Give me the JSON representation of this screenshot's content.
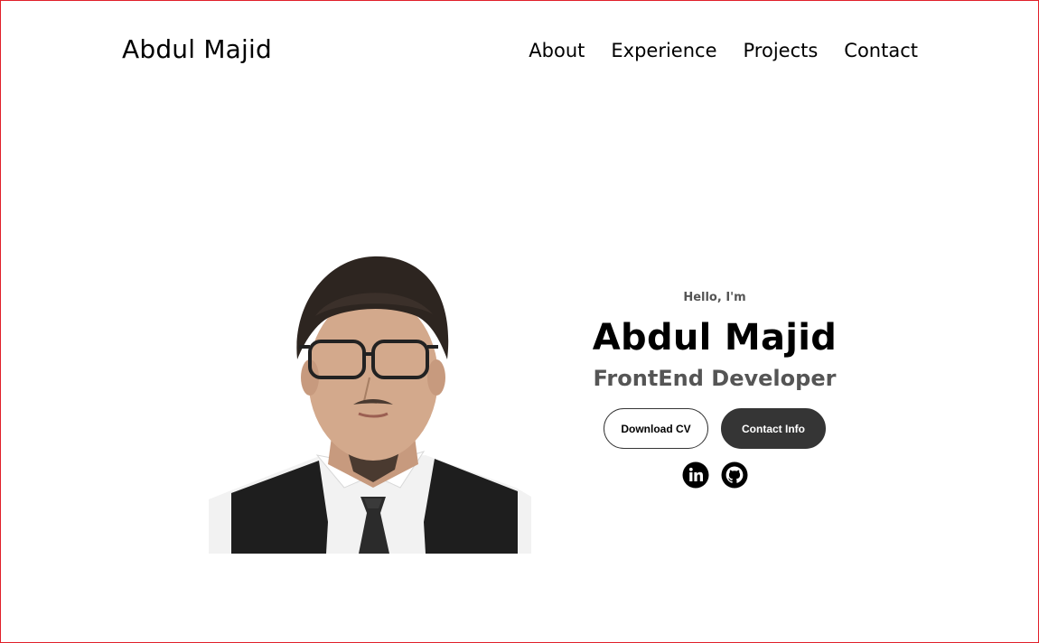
{
  "header": {
    "logo": "Abdul Majid",
    "nav": [
      {
        "label": "About"
      },
      {
        "label": "Experience"
      },
      {
        "label": "Projects"
      },
      {
        "label": "Contact"
      }
    ]
  },
  "hero": {
    "greeting": "Hello, I'm",
    "name": "Abdul Majid",
    "title": "FrontEnd Developer",
    "buttons": {
      "download_cv": "Download CV",
      "contact_info": "Contact Info"
    },
    "socials": [
      {
        "icon": "linkedin-icon"
      },
      {
        "icon": "github-icon"
      }
    ],
    "profile_picture": {
      "alt": "Abdul Majid profile picture"
    }
  },
  "colors": {
    "text": "#000000",
    "secondary_text": "#555555",
    "button_dark": "#353535",
    "frame_border": "#e0202a",
    "background": "#ffffff"
  }
}
